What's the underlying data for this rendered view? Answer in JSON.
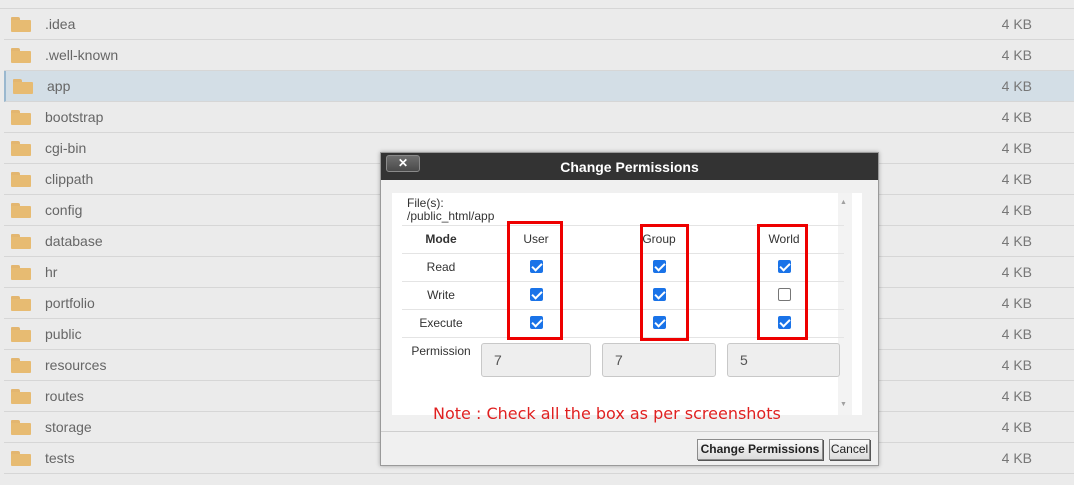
{
  "files": [
    {
      "name": ".idea",
      "size": "4 KB"
    },
    {
      "name": ".well-known",
      "size": "4 KB"
    },
    {
      "name": "app",
      "size": "4 KB",
      "selected": true
    },
    {
      "name": "bootstrap",
      "size": "4 KB"
    },
    {
      "name": "cgi-bin",
      "size": "4 KB"
    },
    {
      "name": "clippath",
      "size": "4 KB"
    },
    {
      "name": "config",
      "size": "4 KB"
    },
    {
      "name": "database",
      "size": "4 KB"
    },
    {
      "name": "hr",
      "size": "4 KB"
    },
    {
      "name": "portfolio",
      "size": "4 KB"
    },
    {
      "name": "public",
      "size": "4 KB"
    },
    {
      "name": "resources",
      "size": "4 KB"
    },
    {
      "name": "routes",
      "size": "4 KB"
    },
    {
      "name": "storage",
      "size": "4 KB"
    },
    {
      "name": "tests",
      "size": "4 KB"
    }
  ],
  "dialog": {
    "title": "Change Permissions",
    "close_label": "✕",
    "files_label": "File(s):",
    "files_path": "/public_html/app",
    "mode_header": "Mode",
    "columns": [
      "User",
      "Group",
      "World"
    ],
    "rows": [
      {
        "label": "Read",
        "checked": [
          true,
          true,
          true
        ]
      },
      {
        "label": "Write",
        "checked": [
          true,
          true,
          false
        ]
      },
      {
        "label": "Execute",
        "checked": [
          true,
          true,
          true
        ]
      }
    ],
    "permission_label": "Permission",
    "permission_values": [
      "7",
      "7",
      "5"
    ],
    "change_button": "Change Permissions",
    "cancel_button": "Cancel"
  },
  "annotation": {
    "note": "Note : Check all the box as per screenshots",
    "highlight_color": "#ee0000"
  },
  "colors": {
    "folder": "#e7bb72",
    "selected_row": "#d3dee6",
    "dialog_header": "#333333",
    "checkbox_checked": "#1a73e8"
  }
}
